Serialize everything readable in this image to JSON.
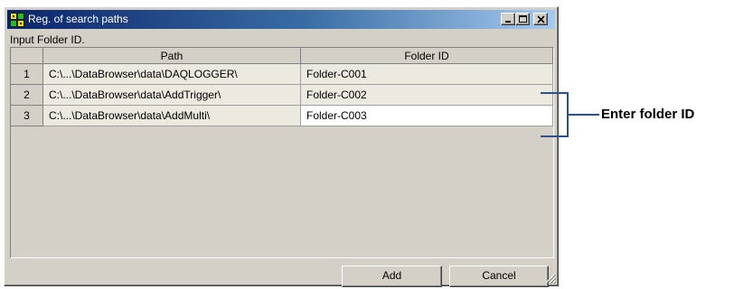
{
  "window": {
    "title": "Reg. of search paths",
    "instruction": "Input Folder ID."
  },
  "grid": {
    "columns": [
      "Path",
      "Folder ID"
    ],
    "rows": [
      {
        "num": "1",
        "path": "C:\\...\\DataBrowser\\data\\DAQLOGGER\\",
        "folder_id": "Folder-C001"
      },
      {
        "num": "2",
        "path": "C:\\...\\DataBrowser\\data\\AddTrigger\\",
        "folder_id": "Folder-C002"
      },
      {
        "num": "3",
        "path": "C:\\...\\DataBrowser\\data\\AddMulti\\",
        "folder_id": "Folder-C003"
      }
    ]
  },
  "buttons": {
    "add": "Add",
    "cancel": "Cancel"
  },
  "callout": {
    "label": "Enter folder ID"
  },
  "colors": {
    "titlebar_start": "#0a246a",
    "titlebar_end": "#a6caf0",
    "face": "#d4d0c8",
    "active_cell": "#ffffff"
  }
}
